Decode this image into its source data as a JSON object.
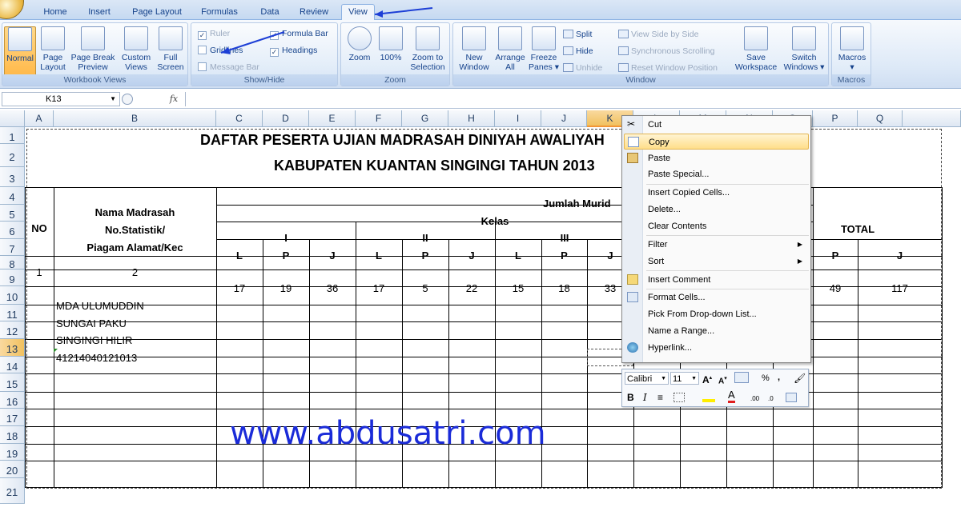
{
  "tabs": [
    "Home",
    "Insert",
    "Page Layout",
    "Formulas",
    "Data",
    "Review",
    "View"
  ],
  "active_tab": "View",
  "ribbon": {
    "workbook_views": {
      "label": "Workbook Views",
      "buttons": [
        {
          "label1": "Normal",
          "label2": ""
        },
        {
          "label1": "Page",
          "label2": "Layout"
        },
        {
          "label1": "Page Break",
          "label2": "Preview"
        },
        {
          "label1": "Custom",
          "label2": "Views"
        },
        {
          "label1": "Full",
          "label2": "Screen"
        }
      ]
    },
    "show_hide": {
      "label": "Show/Hide",
      "ruler": "Ruler",
      "gridlines": "Gridlines",
      "message_bar": "Message Bar",
      "formula_bar": "Formula Bar",
      "headings": "Headings"
    },
    "zoom": {
      "label": "Zoom",
      "buttons": [
        {
          "label1": "Zoom",
          "label2": ""
        },
        {
          "label1": "100%",
          "label2": ""
        },
        {
          "label1": "Zoom to",
          "label2": "Selection"
        }
      ]
    },
    "window": {
      "label": "Window",
      "buttons": [
        {
          "label1": "New",
          "label2": "Window"
        },
        {
          "label1": "Arrange",
          "label2": "All"
        },
        {
          "label1": "Freeze",
          "label2": "Panes ▾"
        }
      ],
      "split": "Split",
      "hide": "Hide",
      "unhide": "Unhide",
      "side_by_side": "View Side by Side",
      "sync_scroll": "Synchronous Scrolling",
      "reset_pos": "Reset Window Position",
      "save_ws1": "Save",
      "save_ws2": "Workspace",
      "switch1": "Switch",
      "switch2": "Windows ▾"
    },
    "macros": {
      "label": "Macros",
      "button": "Macros"
    }
  },
  "formula_bar": {
    "name_box": "K13",
    "fx": "fx",
    "value": ""
  },
  "columns": [
    "A",
    "B",
    "C",
    "D",
    "E",
    "F",
    "G",
    "H",
    "I",
    "J",
    "K",
    "L",
    "M",
    "N",
    "O",
    "P",
    "Q"
  ],
  "rows": [
    "1",
    "2",
    "3",
    "4",
    "5",
    "6",
    "7",
    "8",
    "9",
    "10",
    "11",
    "12",
    "13",
    "14",
    "15",
    "16",
    "17",
    "18",
    "19",
    "20",
    "21"
  ],
  "sheet": {
    "title1": "DAFTAR PESERTA UJIAN MADRASAH DINIYAH AWALIYAH",
    "title2": "KABUPATEN KUANTAN SINGINGI TAHUN 2013",
    "no": "NO",
    "nama1": "Nama Madrasah",
    "nama2": "No.Statistik/",
    "nama3": "Piagam Alamat/Kec",
    "jumlah_murid": "Jumlah Murid",
    "kelas": "Kelas",
    "kelas_i": "I",
    "kelas_ii": "II",
    "kelas_iii": "III",
    "total": "TOTAL",
    "lpj": [
      "L",
      "P",
      "J",
      "L",
      "P",
      "J",
      "L",
      "P",
      "J"
    ],
    "total_pj": [
      "P",
      "J"
    ],
    "num_a": "1",
    "num_b": "2",
    "row9": [
      "17",
      "19",
      "36",
      "17",
      "5",
      "22",
      "15",
      "18",
      "33"
    ],
    "row9_total": [
      "49",
      "117"
    ],
    "madrasah": [
      "MDA ULUMUDDIN",
      "SUNGAI PAKU",
      "SINGINGI HILIR",
      "41214040121013"
    ]
  },
  "context_menu": {
    "items": [
      "Cut",
      "Copy",
      "Paste",
      "Paste Special...",
      "Insert Copied Cells...",
      "Delete...",
      "Clear Contents",
      "Filter",
      "Sort",
      "Insert Comment",
      "Format Cells...",
      "Pick From Drop-down List...",
      "Name a Range...",
      "Hyperlink..."
    ],
    "highlighted": "Copy"
  },
  "mini_toolbar": {
    "font": "Calibri",
    "size": "11",
    "percent": "%",
    "comma": ","
  },
  "watermark": "www.abdusatri.com",
  "colors": {
    "accent_arrow": "#1d3fd6",
    "watermark": "#1a2bd8",
    "selected_header": "#f1c15f"
  }
}
